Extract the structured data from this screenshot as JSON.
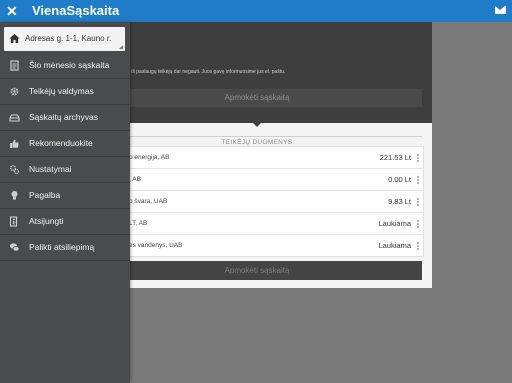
{
  "topbar": {
    "close_icon": "close-icon",
    "title": "VienaSąskaita",
    "mail_icon": "mail-icon"
  },
  "drawer": {
    "address": "Adresas g. 1-1, Kauno r.",
    "items": [
      {
        "label": "Šio mėnesio sąskaita",
        "icon": "document-icon"
      },
      {
        "label": "Teikėjų valdymas",
        "icon": "gear-icon"
      },
      {
        "label": "Sąskaitų archyvas",
        "icon": "archive-icon"
      },
      {
        "label": "Rekomenduokite",
        "icon": "thumbs-up-icon"
      },
      {
        "label": "Nustatymai",
        "icon": "settings-icon"
      },
      {
        "label": "Pagalba",
        "icon": "lightbulb-icon"
      },
      {
        "label": "Atsijungti",
        "icon": "exit-icon"
      },
      {
        "label": "Palikti atsiliepimą",
        "icon": "chat-icon"
      }
    ]
  },
  "main": {
    "note": "ai iš paslaugų teikėjų dar negauti. Juos gavę informuosime jus el. paštu.",
    "pay_top": "Apmokėti sąskaitą",
    "section_title": "TEIKĖJŲ DUOMENYS",
    "providers": [
      {
        "name": "o energija, AB",
        "amount": "221.53 Lt"
      },
      {
        "name": ", AB",
        "amount": "0.00 Lt"
      },
      {
        "name": "o švara, UAB",
        "amount": "9.83 Lt"
      },
      {
        "name": "LT, AB",
        "amount": "Laukiama"
      },
      {
        "name": "es vandenys, UAB",
        "amount": "Laukiama"
      }
    ],
    "pay_bottom": "Apmokėti sąskaitą"
  }
}
